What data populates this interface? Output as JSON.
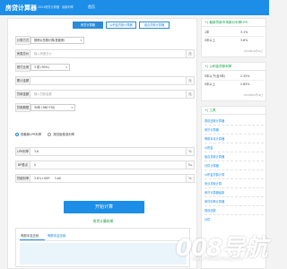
{
  "header": {
    "logo": "房贷计算器",
    "slogan": "2024房贷计算器 · 最新利率",
    "nav_home": "首页"
  },
  "calculator": {
    "tabs": [
      {
        "label": "房贷计算器",
        "active": true
      },
      {
        "label": "公积金贷款计算器",
        "active": false
      },
      {
        "label": "组合贷款计算器",
        "active": false
      }
    ],
    "fields": {
      "method": {
        "label": "计算方式",
        "value": "按房价总额计算(首套房)"
      },
      "unit_price": {
        "label": "房屋总价",
        "placeholder": "输入房屋总价",
        "unit": "元"
      },
      "down_payment": {
        "label": "首付比例",
        "value": "3 成 (30%)"
      },
      "loan_total": {
        "label": "累计金额",
        "unit": "元"
      },
      "loan_amount": {
        "label": "贷款金额",
        "placeholder": "输入贷款金额",
        "unit": "元"
      },
      "loan_term": {
        "label": "贷款期限",
        "value": "30年 (360个月)"
      },
      "lpr": {
        "label": "LPR利率",
        "value": "3.6",
        "unit": "%"
      },
      "bp": {
        "label": "BP基点",
        "value": "0",
        "unit": "‰"
      },
      "rate": {
        "label": "贷款利率",
        "value": "3.6%+0BP",
        "value_extra": "3.60",
        "unit": "%"
      }
    },
    "radios": [
      {
        "label": "按最新LPR利率",
        "checked": true
      },
      {
        "label": "按旧版基准利率",
        "checked": false
      }
    ],
    "calculate_label": "开始计算"
  },
  "results": {
    "title": "房贷计算结果",
    "tabs": [
      {
        "label": "等额本息还款",
        "active": false
      },
      {
        "label": "等额本金还款",
        "active": true
      }
    ]
  },
  "sidebar": {
    "lpr_panel": {
      "title": "+| 最新贷款市场报价利率LPR",
      "note": "2024年10月21日",
      "rows": [
        {
          "term": "1年",
          "rate": "3.1%"
        },
        {
          "term": "5年以上",
          "rate": "3.6%"
        }
      ]
    },
    "fund_panel": {
      "title": "+| 公积金贷款利率",
      "note": "2024年05月18日",
      "rows": [
        {
          "term": "5年以下(含5年)",
          "rate": "2.35%"
        },
        {
          "term": "5年以上",
          "rate": "2.85%"
        }
      ]
    },
    "tools_panel": {
      "title": "+| 工具",
      "links": [
        "提前还款计算器",
        "房贷计算器",
        "等额本息计算器",
        "公积金",
        "组合贷款计算器",
        "月供计算器",
        "公积金贷款计算",
        "商业贷款计算",
        "房贷计算器最新",
        "房贷利率计算器",
        "提前还款",
        "月供"
      ]
    }
  },
  "watermark": {
    "text": "008导航",
    "url": "www.008daohang.com"
  },
  "colors": {
    "accent": "#1c8ee8",
    "title_green": "#1aa34a",
    "panel_bg": "#ffffff",
    "page_bg": "#f3f3f3"
  }
}
